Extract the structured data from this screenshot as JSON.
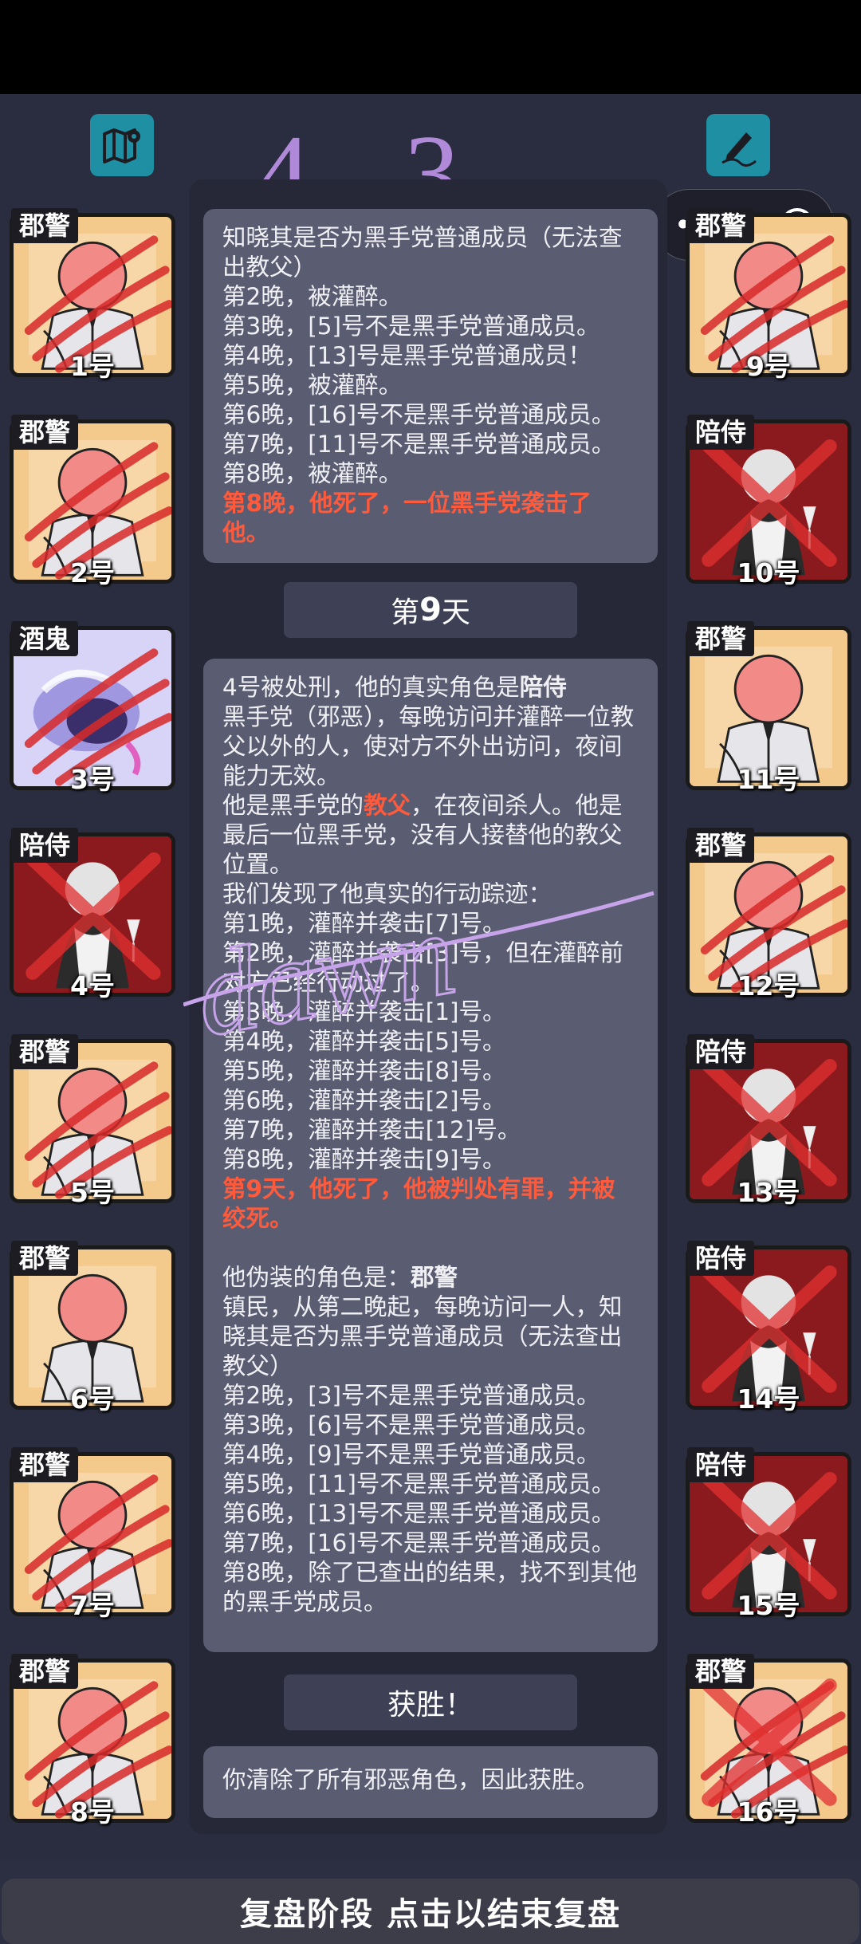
{
  "handwriting_text": "4 - 3",
  "scribble_text": "dawn",
  "players_left": [
    {
      "role": "郡警",
      "number": "1号",
      "portrait": "police",
      "status": "clawed"
    },
    {
      "role": "郡警",
      "number": "2号",
      "portrait": "police",
      "status": "clawed"
    },
    {
      "role": "酒鬼",
      "number": "3号",
      "portrait": "drunk",
      "status": "clawed"
    },
    {
      "role": "陪侍",
      "number": "4号",
      "portrait": "consort",
      "status": "crossed"
    },
    {
      "role": "郡警",
      "number": "5号",
      "portrait": "police",
      "status": "clawed"
    },
    {
      "role": "郡警",
      "number": "6号",
      "portrait": "police",
      "status": "alive"
    },
    {
      "role": "郡警",
      "number": "7号",
      "portrait": "police",
      "status": "clawed"
    },
    {
      "role": "郡警",
      "number": "8号",
      "portrait": "police",
      "status": "clawed"
    }
  ],
  "players_right": [
    {
      "role": "郡警",
      "number": "9号",
      "portrait": "police",
      "status": "clawed"
    },
    {
      "role": "陪侍",
      "number": "10号",
      "portrait": "consort",
      "status": "crossed"
    },
    {
      "role": "郡警",
      "number": "11号",
      "portrait": "police",
      "status": "alive"
    },
    {
      "role": "郡警",
      "number": "12号",
      "portrait": "police",
      "status": "clawed"
    },
    {
      "role": "陪侍",
      "number": "13号",
      "portrait": "consort",
      "status": "crossed"
    },
    {
      "role": "陪侍",
      "number": "14号",
      "portrait": "consort",
      "status": "crossed"
    },
    {
      "role": "陪侍",
      "number": "15号",
      "portrait": "consort",
      "status": "crossed"
    },
    {
      "role": "郡警",
      "number": "16号",
      "portrait": "police",
      "status": "crossed-clawed"
    }
  ],
  "log1": {
    "lines": [
      "知晓其是否为黑手党普通成员（无法查出教父）",
      "第2晚，被灌醉。",
      "第3晚，[5]号不是黑手党普通成员。",
      "第4晚，[13]号是黑手党普通成员！",
      "第5晚，被灌醉。",
      "第6晚，[16]号不是黑手党普通成员。",
      "第7晚，[11]号不是黑手党普通成员。",
      "第8晚，被灌醉。"
    ],
    "death": "第8晚，他死了，一位黑手党袭击了他。"
  },
  "day9": {
    "prefix": "第",
    "num": "9",
    "suffix": "天"
  },
  "log2": {
    "reveal_prefix": "4号被处刑，他的真实角色是",
    "reveal_role": "陪侍",
    "role_desc": "黑手党（邪恶），每晚访问并灌醉一位教父以外的人，使对方不外出访问，夜间能力无效。",
    "godfather_prefix": "他是黑手党的",
    "godfather_word": "教父",
    "godfather_suffix": "，在夜间杀人。他是最后一位黑手党，没有人接替他的教父位置。",
    "track_intro": "我们发现了他真实的行动踪迹：",
    "nights": [
      "第1晚，灌醉并袭击[7]号。",
      "第2晚，灌醉并袭击[3]号，但在灌醉前对方已经行动过了。",
      "第3晚，灌醉并袭击[1]号。",
      "第4晚，灌醉并袭击[5]号。",
      "第5晚，灌醉并袭击[8]号。",
      "第6晚，灌醉并袭击[2]号。",
      "第7晚，灌醉并袭击[12]号。",
      "第8晚，灌醉并袭击[9]号。"
    ],
    "death": "第9天，他死了，他被判处有罪，并被绞死。",
    "fake_prefix": "他伪装的角色是：",
    "fake_role": "郡警",
    "fake_desc": "镇民，从第二晚起，每晚访问一人，知晓其是否为黑手党普通成员（无法查出教父）",
    "fake_nights": [
      "第2晚，[3]号不是黑手党普通成员。",
      "第3晚，[6]号不是黑手党普通成员。",
      "第4晚，[9]号不是黑手党普通成员。",
      "第5晚，[11]号不是黑手党普通成员。",
      "第6晚，[13]号不是黑手党普通成员。",
      "第7晚，[16]号不是黑手党普通成员。",
      "第8晚，除了已查出的结果，找不到其他的黑手党成员。"
    ]
  },
  "victory_header": "获胜！",
  "victory_text": "你清除了所有邪恶角色，因此获胜。",
  "bottom_bar": "复盘阶段 点击以结束复盘",
  "colors": {
    "accent": "#1f8fa3",
    "death_text": "#ff5a3c",
    "log_box": "#5a5d72",
    "card_bg": "#f4c98c"
  }
}
